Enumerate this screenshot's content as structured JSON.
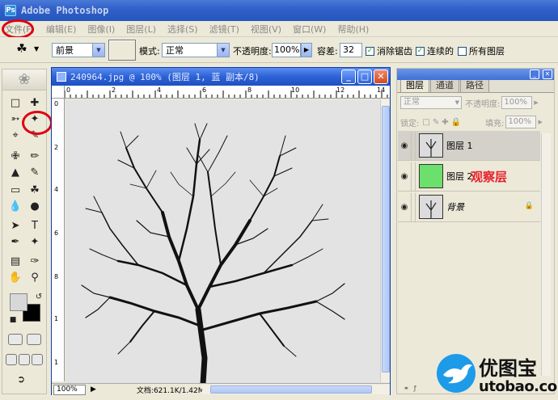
{
  "window": {
    "title": "Adobe Photoshop"
  },
  "menu": [
    "文件(F)",
    "编辑(E)",
    "图像(I)",
    "图层(L)",
    "选择(S)",
    "滤镜(T)",
    "视图(V)",
    "窗口(W)",
    "帮助(H)"
  ],
  "options": {
    "fill_source": "前景",
    "mode_label": "模式:",
    "mode_value": "正常",
    "opacity_label": "不透明度:",
    "opacity_value": "100%",
    "tolerance_label": "容差:",
    "tolerance_value": "32",
    "antialias_label": "消除锯齿",
    "contiguous_label": "连续的",
    "all_layers_label": "所有图层"
  },
  "document": {
    "title": "240964.jpg @ 100% (图层 1, 蓝 副本/8)",
    "zoom": "100%",
    "doc_info": "文档:621.1K/1.42M",
    "ruler_h": [
      "0",
      "2",
      "4",
      "6",
      "8",
      "10",
      "12",
      "14"
    ],
    "ruler_v": [
      "0",
      "2",
      "4",
      "6",
      "8",
      "1",
      "1",
      "1"
    ]
  },
  "layers_panel": {
    "tabs": [
      "图层",
      "通道",
      "路径"
    ],
    "blend_mode": "正常",
    "opacity_label": "不透明度:",
    "opacity_value": "100%",
    "lock_label": "锁定:",
    "fill_label": "填充:",
    "fill_value": "100%",
    "layers": [
      {
        "name": "图层 1",
        "thumb": "tree"
      },
      {
        "name": "图层 2",
        "thumb": "green",
        "annotation": "观察层"
      },
      {
        "name": "背景",
        "thumb": "tree"
      }
    ]
  },
  "watermark": {
    "brand": "优图宝",
    "url": "utobao.com"
  },
  "colors": {
    "titlebar": "#2f5fc8",
    "highlight": "#e00010",
    "green_layer": "#6ce06c"
  }
}
